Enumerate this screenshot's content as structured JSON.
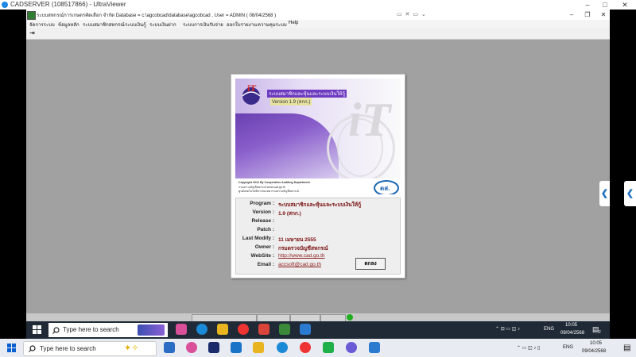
{
  "outer_window": {
    "title": "CADSERVER (108517866) - UltraViewer",
    "controls": [
      "–",
      "□",
      "✕"
    ]
  },
  "remote_app": {
    "title": "ระบบสหกรณ์การเกษตรคัดเลือก จำกัด  Database = c:\\agcobcad\\database\\agcobcad , User = ADMIN ( 08/04/2568 )",
    "uv_tools": "▭ ✕ ▭ ⌄",
    "controls": [
      "–",
      "❐",
      "✕"
    ],
    "menu": [
      "จัดการระบบ",
      "ข้อมูลหลัก",
      "ระบบสมาชิกสหกรณ์",
      "ระบบเงินกู้",
      "ระบบเงินฝาก",
      "ระบบการเงินรับจ่าย",
      "ออกใบรายงาน",
      "ความคุมระบบ",
      "Help"
    ]
  },
  "about": {
    "banner_program": "ระบบสมาชิกและหุ้นและระบบเงินให้กู้",
    "banner_version": "Version 1.9 (สกก.)",
    "footer_lines": [
      "Copyright 2012 By Cooperative Auditing Department",
      "กรมตรวจบัญชีสหกรณ์ www.cad.go.th",
      "ศูนย์เทคโนโลยีสารสนเทศ กรมตรวจบัญชีสหกรณ์"
    ],
    "cad_logo_text": "ตส.",
    "fields": [
      {
        "label": "Program :",
        "value": "ระบบสมาชิกและหุ้นและระบบเงินให้กู้"
      },
      {
        "label": "Version :",
        "value": "1.9 (สกก.)"
      },
      {
        "label": "Release :",
        "value": ""
      },
      {
        "label": "Patch :",
        "value": ""
      },
      {
        "label": "Last Modify :",
        "value": "11 เมษายน 2555"
      },
      {
        "label": "Owner :",
        "value": "กรมตรวจบัญชีสหกรณ์"
      },
      {
        "label": "WebSite :",
        "value": "http://www.cad.go.th"
      },
      {
        "label": "Email :",
        "value": "accsoft@cad.go.th"
      }
    ],
    "ok_label": "ตกลง"
  },
  "inner_taskbar": {
    "search_placeholder": "Type here to search",
    "lang": "ENG",
    "time": "10:05",
    "date": "09/04/2568",
    "notif_count": "2"
  },
  "outer_taskbar": {
    "search_placeholder": "Type here to search",
    "lang": "ENG",
    "time": "10:05",
    "date": "09/04/2568"
  },
  "colors": {
    "accent_blue": "#1e6fc0",
    "splash_purple": "#6d3ac0",
    "status_green": "#1fae1f",
    "value_red": "#7a1010"
  }
}
